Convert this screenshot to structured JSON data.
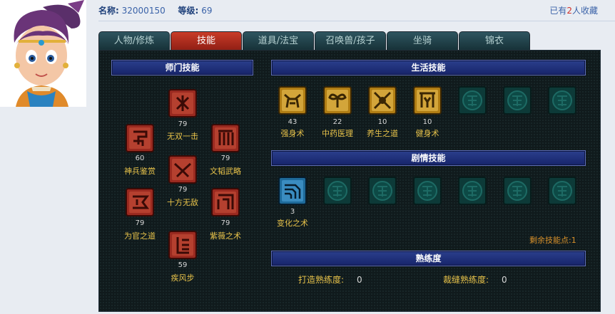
{
  "header": {
    "name_label": "名称:",
    "name_value": "32000150",
    "level_label": "等级:",
    "level_value": "69",
    "fav_prefix": "已有",
    "fav_count": "2",
    "fav_suffix": "人收藏"
  },
  "tabs": [
    {
      "label": "人物/修炼",
      "active": false
    },
    {
      "label": "技能",
      "active": true
    },
    {
      "label": "道具/法宝",
      "active": false
    },
    {
      "label": "召唤兽/孩子",
      "active": false
    },
    {
      "label": "坐骑",
      "active": false
    },
    {
      "label": "锦衣",
      "active": false
    }
  ],
  "sections": {
    "school": "师门技能",
    "life": "生活技能",
    "story": "剧情技能",
    "proficiency": "熟练度"
  },
  "school_skills": [
    {
      "name": "无双一击",
      "level": "79",
      "icon": "skill-wushuang-icon"
    },
    {
      "name": "神兵鉴赏",
      "level": "60",
      "icon": "skill-shenbing-icon"
    },
    {
      "name": "文韬武略",
      "level": "79",
      "icon": "skill-wentao-icon"
    },
    {
      "name": "十方无敌",
      "level": "79",
      "icon": "skill-shifang-icon"
    },
    {
      "name": "为官之道",
      "level": "79",
      "icon": "skill-weiguan-icon"
    },
    {
      "name": "紫薇之术",
      "level": "79",
      "icon": "skill-ziwei-icon"
    },
    {
      "name": "疾风步",
      "level": "59",
      "icon": "skill-jifeng-icon"
    }
  ],
  "life_skills": [
    {
      "name": "强身术",
      "level": "43"
    },
    {
      "name": "中药医理",
      "level": "22"
    },
    {
      "name": "养生之道",
      "level": "10"
    },
    {
      "name": "健身术",
      "level": "10"
    }
  ],
  "story_skills": [
    {
      "name": "变化之术",
      "level": "3"
    }
  ],
  "remaining": "剩余技能点:1",
  "proficiency": {
    "forge_label": "打造熟练度:",
    "forge_value": "0",
    "tailor_label": "裁缝熟练度:",
    "tailor_value": "0"
  },
  "colors": {
    "school_icon": "#9a2a20",
    "life_icon": "#b07d14",
    "story_icon": "#1e6a9a",
    "empty_slot": "#0d4a46",
    "skill_label": "#e7c24a"
  }
}
